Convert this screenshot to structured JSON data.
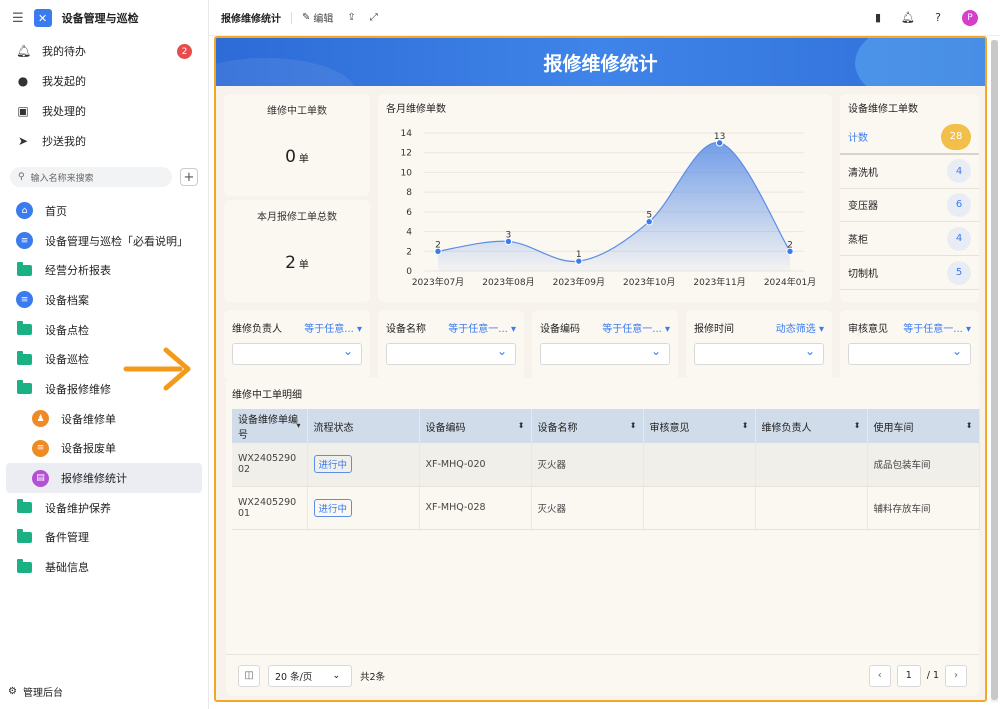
{
  "app": {
    "title": "设备管理与巡检"
  },
  "sidebar": {
    "top_items": [
      {
        "label": "我的待办",
        "badge": "2"
      },
      {
        "label": "我发起的"
      },
      {
        "label": "我处理的"
      },
      {
        "label": "抄送我的"
      }
    ],
    "search_placeholder": "输入名称来搜索",
    "nav": [
      {
        "label": "首页"
      },
      {
        "label": "设备管理与巡检「必看说明」"
      },
      {
        "label": "经营分析报表"
      },
      {
        "label": "设备档案"
      },
      {
        "label": "设备点检"
      },
      {
        "label": "设备巡检"
      },
      {
        "label": "设备报修维修"
      },
      {
        "label": "设备维修单"
      },
      {
        "label": "设备报废单"
      },
      {
        "label": "报修维修统计"
      },
      {
        "label": "设备维护保养"
      },
      {
        "label": "备件管理"
      },
      {
        "label": "基础信息"
      }
    ],
    "footer": "管理后台"
  },
  "topbar": {
    "title": "报修维修统计",
    "edit": "编辑",
    "avatar": "P"
  },
  "banner": {
    "title": "报修维修统计"
  },
  "kpi": {
    "in_progress": {
      "label": "维修中工单数",
      "value": "0",
      "unit": "单"
    },
    "monthly": {
      "label": "本月报修工单总数",
      "value": "2",
      "unit": "单"
    }
  },
  "chart_data": {
    "type": "area",
    "title": "各月维修单数",
    "categories": [
      "2023年07月",
      "2023年08月",
      "2023年09月",
      "2023年10月",
      "2023年11月",
      "2024年01月"
    ],
    "values": [
      2,
      3,
      1,
      5,
      13,
      2
    ],
    "ylim": [
      0,
      14
    ],
    "yticks": [
      0,
      2,
      4,
      6,
      8,
      10,
      12,
      14
    ],
    "color": "#5b8ee6"
  },
  "device_stats": {
    "title": "设备维修工单数",
    "rows": [
      {
        "label": "计数",
        "value": "28"
      },
      {
        "label": "清洗机",
        "value": "4"
      },
      {
        "label": "变压器",
        "value": "6"
      },
      {
        "label": "蒸柜",
        "value": "4"
      },
      {
        "label": "切制机",
        "value": "5"
      }
    ]
  },
  "filters": [
    {
      "label": "维修负责人",
      "op": "等于任意... ▾"
    },
    {
      "label": "设备名称",
      "op": "等于任意一... ▾"
    },
    {
      "label": "设备编码",
      "op": "等于任意一... ▾"
    },
    {
      "label": "报修时间",
      "op": "动态筛选 ▾"
    },
    {
      "label": "审核意见",
      "op": "等于任意一... ▾"
    }
  ],
  "table": {
    "title": "维修中工单明细",
    "headers": [
      "设备维修单编号",
      "流程状态",
      "设备编码",
      "设备名称",
      "审核意见",
      "维修负责人",
      "使用车间"
    ],
    "rows": [
      {
        "id": "WX240529002",
        "status": "进行中",
        "code": "XF-MHQ-020",
        "name": "灭火器",
        "review": "",
        "owner": "",
        "workshop": "成品包装车间"
      },
      {
        "id": "WX240529001",
        "status": "进行中",
        "code": "XF-MHQ-028",
        "name": "灭火器",
        "review": "",
        "owner": "",
        "workshop": "辅料存放车间"
      }
    ]
  },
  "pager": {
    "size": "20 条/页",
    "total": "共2条",
    "page": "1",
    "pages": "/ 1"
  }
}
